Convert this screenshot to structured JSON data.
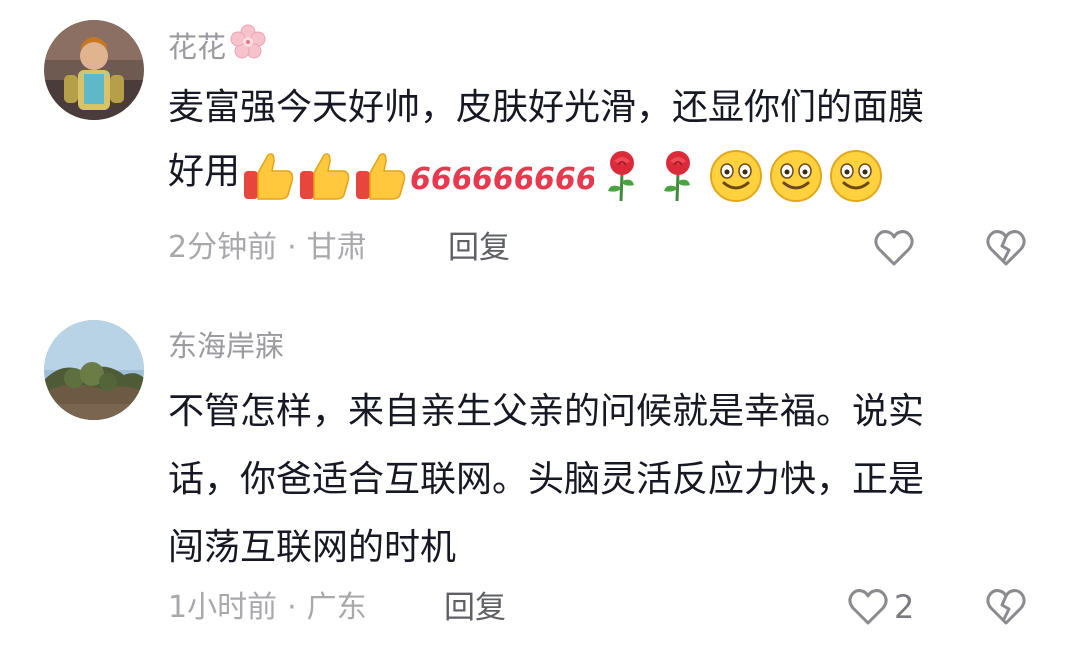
{
  "comments": [
    {
      "username": "花花",
      "username_flower_icon": "cherry-blossom-icon",
      "text_lines": [
        "麦富强今天好帅，皮肤好光滑，还显你们的面膜",
        "好用"
      ],
      "emoji_sequence": [
        "thumbs-up-icon",
        "thumbs-up-icon",
        "thumbs-up-icon",
        "666-icon",
        "666-icon",
        "666-icon",
        "rose-icon",
        "rose-icon",
        "smile-icon",
        "smile-icon",
        "smile-icon"
      ],
      "emoji_666_text": "666",
      "time": "2分钟前",
      "separator": "·",
      "location": "甘肃",
      "reply_label": "回复",
      "like_count": ""
    },
    {
      "username": "东海岸寐",
      "text_lines": [
        "不管怎样，来自亲生父亲的问候就是幸福。说实",
        "话，你爸适合互联网。头脑灵活反应力快，正是",
        "闯荡互联网的时机"
      ],
      "time": "1小时前",
      "separator": "·",
      "location": "广东",
      "reply_label": "回复",
      "like_count": "2"
    }
  ],
  "colors": {
    "username": "#9a9aa0",
    "text": "#161823",
    "meta": "#a8a8ad",
    "reply": "#5f6066",
    "icon_stroke": "#8a8a90"
  }
}
